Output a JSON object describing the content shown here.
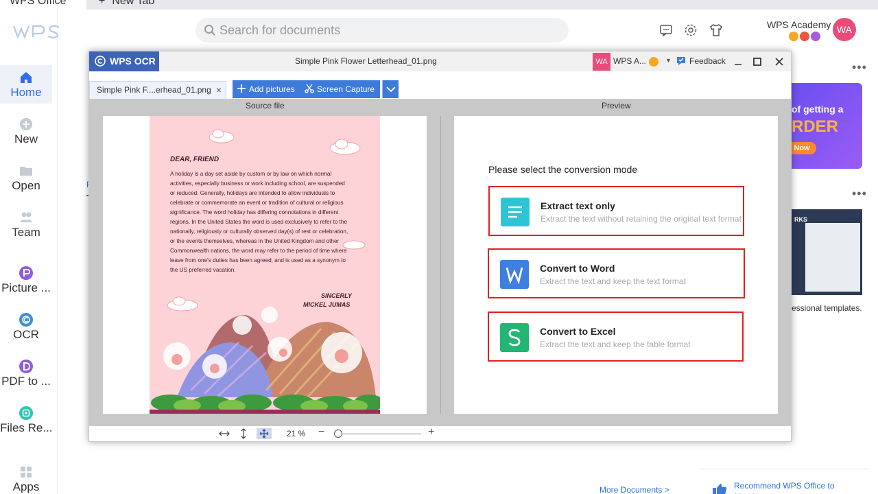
{
  "app": {
    "name": "WPS Office",
    "new_tab": "New Tab"
  },
  "sidebar": {
    "items": [
      {
        "label": "Home",
        "icon": "home-icon",
        "active": true
      },
      {
        "label": "New",
        "icon": "plus-circle-icon"
      },
      {
        "label": "Open",
        "icon": "folder-icon"
      },
      {
        "label": "Team",
        "icon": "team-icon"
      },
      {
        "label": "Picture ...",
        "icon": "picture-icon"
      },
      {
        "label": "OCR",
        "icon": "ocr-icon"
      },
      {
        "label": "PDF to ...",
        "icon": "pdf-icon"
      },
      {
        "label": "Files Re...",
        "icon": "files-recovery-icon"
      },
      {
        "label": "Apps",
        "icon": "apps-icon"
      }
    ]
  },
  "header": {
    "search_placeholder": "Search for documents",
    "account_name": "WPS Academy",
    "avatar_initials": "WA"
  },
  "right_panel": {
    "promo_line1": "of getting a",
    "promo_line2": "RDER",
    "promo_button": "Now",
    "template_label": "RKS",
    "template_caption": "essional templates.",
    "more_documents": "More Documents >",
    "recommend": "Recommend WPS Office to friends"
  },
  "dialog": {
    "brand": "WPS OCR",
    "title": "Simple Pink Flower Letterhead_01.png",
    "user_initials": "WA",
    "user_name": "WPS A...",
    "feedback": "Feedback",
    "file_tab": "Simple Pink F....erhead_01.png",
    "add_pictures": "Add pictures",
    "screen_capture": "Screen Capture",
    "source_label": "Source file",
    "preview_label": "Preview",
    "zoom": "21 %",
    "zoom_fraction": 0.0,
    "letter": {
      "greeting": "DEAR, FRIEND",
      "body": "A holiday is a day set aside by custom or by law on which normal activities, especially business or work including school, are suspended or reduced. Generally, holidays are intended to allow individuals to celebrate or commemorate an event or tradition of cultural or religious significance. The word holiday has differing connotations in different regions. In the United States the word is used exclusively to refer to the nationally, religiously or culturally observed day(s) of rest or celebration, or the events themselves, whereas in the United Kingdom and other Commonwealth nations, the word may refer to the period of time where leave from one's duties has been agreed, and is used as a synonym to the US preferred vacation.",
      "sign_off": "SINCERLY",
      "signature": "MICKEL JUMAS"
    },
    "conversion": {
      "heading": "Please select the conversion mode",
      "modes": [
        {
          "title": "Extract text only",
          "desc": "Extract the text without retaining the original text format",
          "icon": "text-lines-icon",
          "color": "#2ec4d6"
        },
        {
          "title": "Convert to Word",
          "desc": "Extract the text and keep the text format",
          "icon": "word-icon",
          "color": "#3f7fe0"
        },
        {
          "title": "Convert to Excel",
          "desc": "Extract the text and keep the table format",
          "icon": "excel-icon",
          "color": "#22b573"
        }
      ]
    }
  },
  "colors": {
    "accent": "#2e6ee6",
    "ocr_brand": "#3c63b6",
    "toolbar_button": "#3d7bda",
    "highlight_border": "#e02020",
    "avatar": "#e94b7a"
  }
}
